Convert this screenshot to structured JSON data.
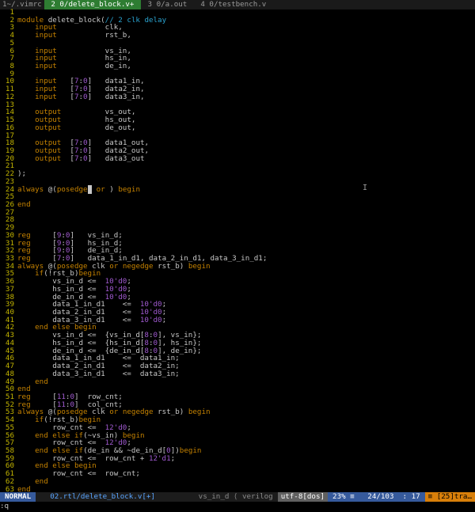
{
  "tabs": [
    {
      "label": "1~/.vimrc",
      "active": false
    },
    {
      "label": " 2 0/delete_block.v+ ",
      "active": true
    },
    {
      "label": " 3 0/a.out ",
      "active": false
    },
    {
      "label": " 4 0/testbench.v ",
      "active": false
    }
  ],
  "lines": [
    {
      "n": "1",
      "html": ""
    },
    {
      "n": "2",
      "html": "<span class='k'>module</span> delete_block(<span class='c'>// 2 clk delay</span>"
    },
    {
      "n": "3",
      "html": "    <span class='k'>input</span>           clk,"
    },
    {
      "n": "4",
      "html": "    <span class='k'>input</span>           rst_b,"
    },
    {
      "n": "5",
      "html": ""
    },
    {
      "n": "6",
      "html": "    <span class='k'>input</span>           vs_in,"
    },
    {
      "n": "7",
      "html": "    <span class='k'>input</span>           hs_in,"
    },
    {
      "n": "8",
      "html": "    <span class='k'>input</span>           de_in,"
    },
    {
      "n": "9",
      "html": ""
    },
    {
      "n": "10",
      "html": "    <span class='k'>input</span>   [<span class='n'>7</span>:<span class='n'>0</span>]   data1_in,"
    },
    {
      "n": "11",
      "html": "    <span class='k'>input</span>   [<span class='n'>7</span>:<span class='n'>0</span>]   data2_in,"
    },
    {
      "n": "12",
      "html": "    <span class='k'>input</span>   [<span class='n'>7</span>:<span class='n'>0</span>]   data3_in,"
    },
    {
      "n": "13",
      "html": ""
    },
    {
      "n": "14",
      "html": "    <span class='k'>output</span>          vs_out,"
    },
    {
      "n": "15",
      "html": "    <span class='k'>output</span>          hs_out,"
    },
    {
      "n": "16",
      "html": "    <span class='k'>output</span>          de_out,"
    },
    {
      "n": "17",
      "html": ""
    },
    {
      "n": "18",
      "html": "    <span class='k'>output</span>  [<span class='n'>7</span>:<span class='n'>0</span>]   data1_out,"
    },
    {
      "n": "19",
      "html": "    <span class='k'>output</span>  [<span class='n'>7</span>:<span class='n'>0</span>]   data2_out,"
    },
    {
      "n": "20",
      "html": "    <span class='k'>output</span>  [<span class='n'>7</span>:<span class='n'>0</span>]   data3_out"
    },
    {
      "n": "21",
      "html": ""
    },
    {
      "n": "22",
      "html": ");"
    },
    {
      "n": "23",
      "html": ""
    },
    {
      "n": "24",
      "html": "<span class='k'>always</span> @(<span class='k'>posedge</span><span class='cursor'> </span> <span class='k'>or</span> ) <span class='k'>begin</span>"
    },
    {
      "n": "25",
      "html": ""
    },
    {
      "n": "26",
      "html": "<span class='k'>end</span>"
    },
    {
      "n": "27",
      "html": ""
    },
    {
      "n": "28",
      "html": ""
    },
    {
      "n": "29",
      "html": ""
    },
    {
      "n": "30",
      "html": "<span class='k'>reg</span>     [<span class='n'>9</span>:<span class='n'>0</span>]   vs_in_d;"
    },
    {
      "n": "31",
      "html": "<span class='k'>reg</span>     [<span class='n'>9</span>:<span class='n'>0</span>]   hs_in_d;"
    },
    {
      "n": "32",
      "html": "<span class='k'>reg</span>     [<span class='n'>9</span>:<span class='n'>0</span>]   de_in_d;"
    },
    {
      "n": "33",
      "html": "<span class='k'>reg</span>     [<span class='n'>7</span>:<span class='n'>0</span>]   data_1_in_d1, data_2_in_d1, data_3_in_d1;"
    },
    {
      "n": "34",
      "html": "<span class='k'>always</span> @(<span class='k'>posedge</span> clk <span class='k'>or</span> <span class='k'>negedge</span> rst_b) <span class='k'>begin</span>"
    },
    {
      "n": "35",
      "html": "    <span class='k'>if</span>(!rst_b)<span class='k'>begin</span>"
    },
    {
      "n": "36",
      "html": "        vs_in_d <=  <span class='n'>10'd0</span>;"
    },
    {
      "n": "37",
      "html": "        hs_in_d <=  <span class='n'>10'd0</span>;"
    },
    {
      "n": "38",
      "html": "        de_in_d <=  <span class='n'>10'd0</span>;"
    },
    {
      "n": "39",
      "html": "        data_1_in_d1    <=  <span class='n'>10'd0</span>;"
    },
    {
      "n": "40",
      "html": "        data_2_in_d1    <=  <span class='n'>10'd0</span>;"
    },
    {
      "n": "41",
      "html": "        data_3_in_d1    <=  <span class='n'>10'd0</span>;"
    },
    {
      "n": "42",
      "html": "    <span class='k'>end</span> <span class='k'>else</span> <span class='k'>begin</span>"
    },
    {
      "n": "43",
      "html": "        vs_in_d <=  {vs_in_d[<span class='n'>8</span>:<span class='n'>0</span>], vs_in};"
    },
    {
      "n": "44",
      "html": "        hs_in_d <=  {hs_in_d[<span class='n'>8</span>:<span class='n'>0</span>], hs_in};"
    },
    {
      "n": "45",
      "html": "        de_in_d <=  {de_in_d[<span class='n'>8</span>:<span class='n'>0</span>], de_in};"
    },
    {
      "n": "46",
      "html": "        data_1_in_d1    <=  data1_in;"
    },
    {
      "n": "47",
      "html": "        data_2_in_d1    <=  data2_in;"
    },
    {
      "n": "48",
      "html": "        data_3_in_d1    <=  data3_in;"
    },
    {
      "n": "49",
      "html": "    <span class='k'>end</span>"
    },
    {
      "n": "50",
      "html": "<span class='k'>end</span>"
    },
    {
      "n": "51",
      "html": "<span class='k'>reg</span>     [<span class='n'>11</span>:<span class='n'>0</span>]  row_cnt;"
    },
    {
      "n": "52",
      "html": "<span class='k'>reg</span>     [<span class='n'>11</span>:<span class='n'>0</span>]  col_cnt;"
    },
    {
      "n": "53",
      "html": "<span class='k'>always</span> @(<span class='k'>posedge</span> clk <span class='k'>or</span> <span class='k'>negedge</span> rst_b) <span class='k'>begin</span>"
    },
    {
      "n": "54",
      "html": "    <span class='k'>if</span>(!rst_b)<span class='k'>begin</span>"
    },
    {
      "n": "55",
      "html": "        row_cnt <=  <span class='n'>12'd0</span>;"
    },
    {
      "n": "56",
      "html": "    <span class='k'>end</span> <span class='k'>else</span> <span class='k'>if</span>(~vs_in) <span class='k'>begin</span>"
    },
    {
      "n": "57",
      "html": "        row_cnt <=  <span class='n'>12'd0</span>;"
    },
    {
      "n": "58",
      "html": "    <span class='k'>end</span> <span class='k'>else</span> <span class='k'>if</span>(de_in && ~de_in_d[<span class='n'>0</span>])<span class='k'>begin</span>"
    },
    {
      "n": "59",
      "html": "        row_cnt <=  row_cnt + <span class='n'>12'd1</span>;"
    },
    {
      "n": "60",
      "html": "    <span class='k'>end</span> <span class='k'>else</span> <span class='k'>begin</span>"
    },
    {
      "n": "61",
      "html": "        row_cnt <=  row_cnt;"
    },
    {
      "n": "62",
      "html": "    <span class='k'>end</span>"
    },
    {
      "n": "63",
      "html": "<span class='k'>end</span>"
    }
  ],
  "status": {
    "mode": "NORMAL",
    "file": "02.rtl/delete_block.v[+]",
    "context": "vs_in_d ⟨ verilog",
    "encoding": "utf-8[dos]",
    "position": "23% ≡   24/103  : 17",
    "warning": "≡ [25]tra…"
  },
  "cmdline": ":q"
}
